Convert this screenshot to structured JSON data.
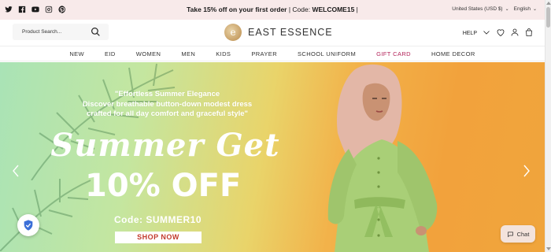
{
  "topbar": {
    "social_icons": [
      "twitter-icon",
      "facebook-icon",
      "youtube-icon",
      "instagram-icon",
      "pinterest-icon"
    ],
    "promo_text": "Take 15% off on your first order",
    "promo_sep": " | Code: ",
    "promo_code": "WELCOME15",
    "promo_tail": " |",
    "currency": "United States (USD $)",
    "language": "English"
  },
  "header": {
    "search_placeholder": "Product Search...",
    "logo_text": "EAST ESSENCE",
    "help_label": "HELP"
  },
  "nav": {
    "items": [
      "NEW",
      "EID",
      "WOMEN",
      "MEN",
      "KIDS",
      "PRAYER",
      "SCHOOL UNIFORM",
      "GIFT CARD",
      "HOME DECOR"
    ]
  },
  "hero": {
    "quote_line1": "\"Effortless Summer Elegance",
    "quote_line2": "Discover breathable button-down modest dress",
    "quote_line3": "crafted for all day comfort and graceful style\"",
    "script_title": "Summer Get",
    "discount": "10% OFF",
    "code": "Code: SUMMER10",
    "cta": "SHOP NOW"
  },
  "chat": {
    "label": "Chat"
  },
  "colors": {
    "accent_gift": "#b3245a",
    "topbar_bg": "#f8eaea",
    "cta_text": "#c23a2c"
  }
}
